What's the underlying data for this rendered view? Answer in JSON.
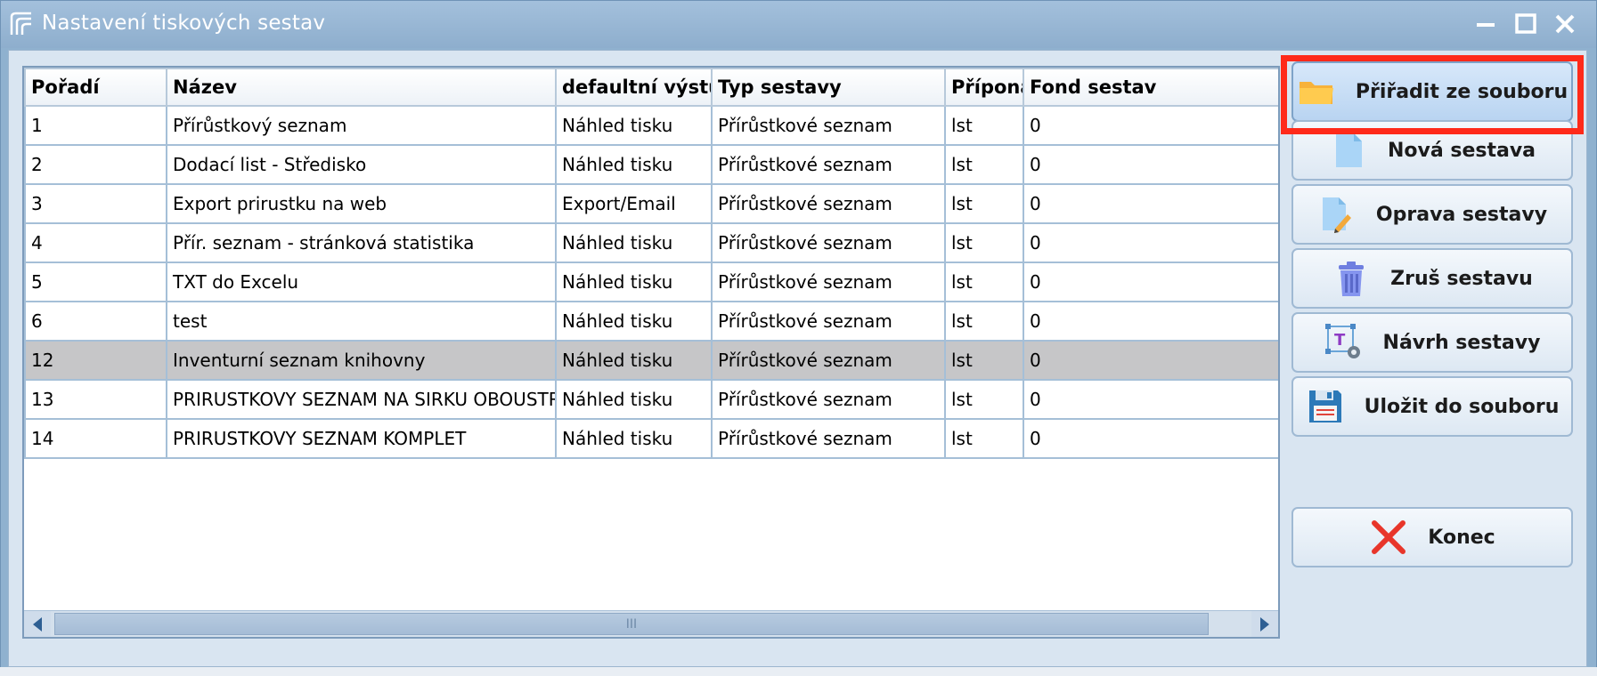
{
  "window": {
    "title": "Nastavení tiskových sestav"
  },
  "table": {
    "columns": [
      "Pořadí",
      "Název",
      "defaultní výstup",
      "Typ sestavy",
      "Přípona",
      "Fond sestav"
    ],
    "rows": [
      [
        "1",
        "Přírůstkový seznam",
        "Náhled tisku",
        "Přírůstkové seznam",
        "lst",
        "0"
      ],
      [
        "2",
        "Dodací list - Středisko",
        "Náhled tisku",
        "Přírůstkové seznam",
        "lst",
        "0"
      ],
      [
        "3",
        "Export prirustku na web",
        "Export/Email",
        "Přírůstkové seznam",
        "lst",
        "0"
      ],
      [
        "4",
        "Přír. seznam - stránková statistika",
        "Náhled tisku",
        "Přírůstkové seznam",
        "lst",
        "0"
      ],
      [
        "5",
        "TXT do Excelu",
        "Náhled tisku",
        "Přírůstkové seznam",
        "lst",
        "0"
      ],
      [
        "6",
        "test",
        "Náhled tisku",
        "Přírůstkové seznam",
        "lst",
        "0"
      ],
      [
        "12",
        "Inventurní seznam knihovny",
        "Náhled tisku",
        "Přírůstkové seznam",
        "lst",
        "0"
      ],
      [
        "13",
        "PRIRUSTKOVY SEZNAM NA SIRKU OBOUSTRANNY",
        "Náhled tisku",
        "Přírůstkové seznam",
        "lst",
        "0"
      ],
      [
        "14",
        "PRIRUSTKOVY SEZNAM KOMPLET",
        "Náhled tisku",
        "Přírůstkové seznam",
        "lst",
        "0"
      ]
    ],
    "selected_row_index": 6
  },
  "scrollbar": {
    "thumb_grip": "III"
  },
  "buttons": {
    "assign_from_file": {
      "label": "Přiřadit ze souboru",
      "icon": "folder-icon"
    },
    "new_report": {
      "label": "Nová sestava",
      "icon": "new-document-icon"
    },
    "edit_report": {
      "label": "Oprava sestavy",
      "icon": "edit-document-icon"
    },
    "delete_report": {
      "label": "Zruš sestavu",
      "icon": "trash-icon"
    },
    "design_report": {
      "label": "Návrh sestavy",
      "icon": "design-icon"
    },
    "save_to_file": {
      "label": "Uložit do souboru",
      "icon": "floppy-icon"
    },
    "close": {
      "label": "Konec",
      "icon": "close-x-icon"
    }
  },
  "colors": {
    "highlight": "#ff2a1a",
    "selected_row": "#c6c6c8",
    "titlebar": "#9bb9d6"
  }
}
